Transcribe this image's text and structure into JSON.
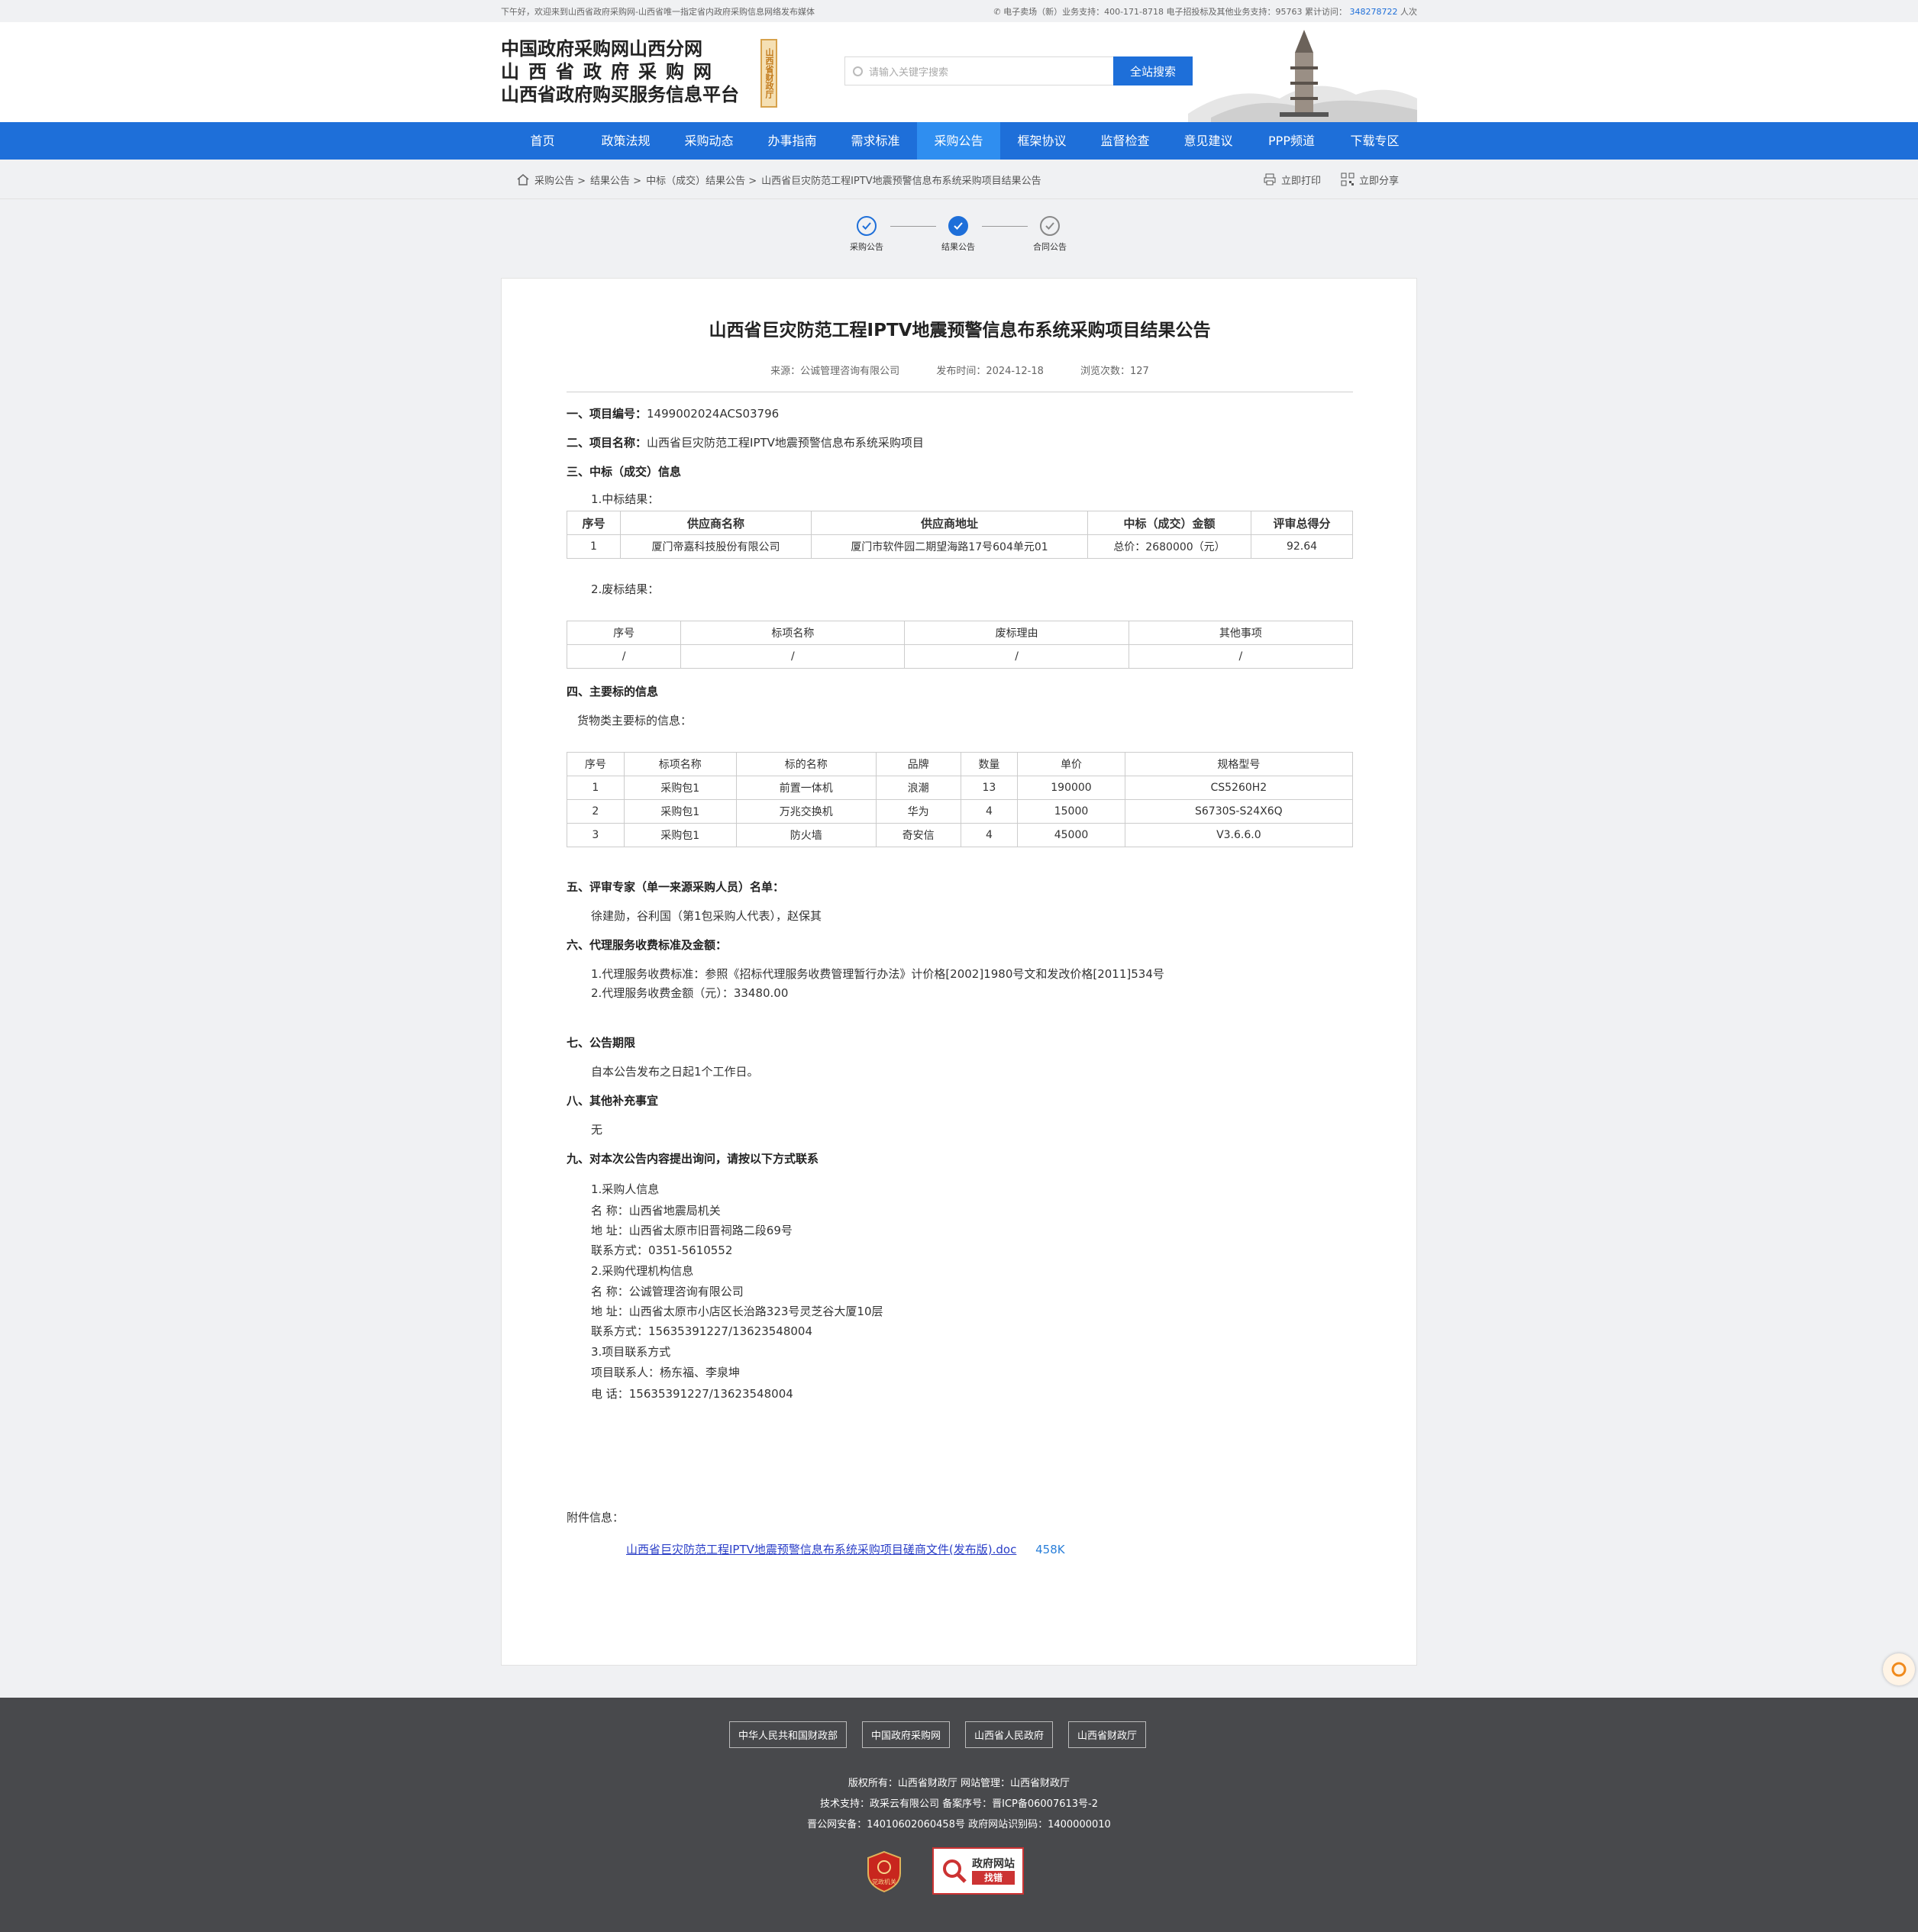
{
  "topbar": {
    "welcome": "下午好，欢迎来到山西省政府采购网-山西省唯一指定省内政府采购信息网络发布媒体",
    "support": "电子卖场（新）业务支持：400-171-8718 电子招投标及其他业务支持：95763",
    "visit_label": "累计访问：",
    "visit_count": "348278722",
    "visit_unit": "人次"
  },
  "logo": {
    "line1": "中国政府采购网山西分网",
    "line2": "山西省政府采购网",
    "line3": "山西省政府购买服务信息平台",
    "seal": "山西省财政厅"
  },
  "search": {
    "placeholder": "请输入关键字搜索",
    "button": "全站搜索"
  },
  "nav": [
    "首页",
    "政策法规",
    "采购动态",
    "办事指南",
    "需求标准",
    "采购公告",
    "框架协议",
    "监督检查",
    "意见建议",
    "PPP频道",
    "下载专区"
  ],
  "breadcrumb": [
    "采购公告 >",
    "结果公告 >",
    "中标（成交）结果公告 >",
    "山西省巨灾防范工程IPTV地震预警信息布系统采购项目结果公告"
  ],
  "tools": {
    "print": "立即打印",
    "share": "立即分享"
  },
  "steps": [
    "采购公告",
    "结果公告",
    "合同公告"
  ],
  "article": {
    "title": "山西省巨灾防范工程IPTV地震预警信息布系统采购项目结果公告",
    "source": "来源：公诚管理咨询有限公司",
    "date": "发布时间：2024-12-18",
    "views": "浏览次数：127",
    "s1_label": "一、项目编号：",
    "s1_value": "1499002024ACS03796",
    "s2_label": "二、项目名称：",
    "s2_value": "山西省巨灾防范工程IPTV地震预警信息布系统采购项目",
    "s3": "三、中标（成交）信息",
    "s3_sub1": "1.中标结果：",
    "win_headers": [
      "序号",
      "供应商名称",
      "供应商地址",
      "中标（成交）金额",
      "评审总得分"
    ],
    "win_row": [
      "1",
      "厦门帝嘉科技股份有限公司",
      "厦门市软件园二期望海路17号604单元01",
      "总价：2680000（元）",
      "92.64"
    ],
    "s3_sub2": "2.废标结果：",
    "fail_headers": [
      "序号",
      "标项名称",
      "废标理由",
      "其他事项"
    ],
    "fail_row": [
      "/",
      "/",
      "/",
      "/"
    ],
    "s4": "四、主要标的信息",
    "s4_sub": "货物类主要标的信息：",
    "goods_headers": [
      "序号",
      "标项名称",
      "标的名称",
      "品牌",
      "数量",
      "单价",
      "规格型号"
    ],
    "goods_rows": [
      [
        "1",
        "采购包1",
        "前置一体机",
        "浪潮",
        "13",
        "190000",
        "CS5260H2"
      ],
      [
        "2",
        "采购包1",
        "万兆交换机",
        "华为",
        "4",
        "15000",
        "S6730S-S24X6Q"
      ],
      [
        "3",
        "采购包1",
        "防火墙",
        "奇安信",
        "4",
        "45000",
        "V3.6.6.0"
      ]
    ],
    "s5": "五、评审专家（单一来源采购人员）名单：",
    "s5_value": "徐建勋，谷利国（第1包采购人代表），赵保其",
    "s6": "六、代理服务收费标准及金额：",
    "s6_line1": "1.代理服务收费标准：参照《招标代理服务收费管理暂行办法》计价格[2002]1980号文和发改价格[2011]534号",
    "s6_line2": "2.代理服务收费金额（元）：33480.00",
    "s7": "七、公告期限",
    "s7_value": "自本公告发布之日起1个工作日。",
    "s8": "八、其他补充事宜",
    "s8_value": "无",
    "s9": "九、对本次公告内容提出询问，请按以下方式联系",
    "contact": [
      "1.采购人信息",
      "名 称：山西省地震局机关",
      "地 址：山西省太原市旧晋祠路二段69号",
      "联系方式：0351-5610552",
      "2.采购代理机构信息",
      "名 称：公诚管理咨询有限公司",
      "地 址：山西省太原市小店区长治路323号灵芝谷大厦10层",
      "联系方式：15635391227/13623548004",
      "3.项目联系方式",
      "项目联系人：杨东福、李泉坤",
      "电 话：15635391227/13623548004"
    ],
    "attach_label": "附件信息：",
    "attach_name": "山西省巨灾防范工程IPTV地震预警信息布系统采购项目磋商文件(发布版).doc",
    "attach_size": "458K"
  },
  "footer": {
    "links": [
      "中华人民共和国财政部",
      "中国政府采购网",
      "山西省人民政府",
      "山西省财政厅"
    ],
    "line1": "版权所有：山西省财政厅 网站管理：山西省财政厅",
    "line2": "技术支持：政采云有限公司 备案序号：晋ICP备06007613号-2",
    "line3": "晋公网安备：14010602060458号 政府网站识别码：1400000010",
    "badge_text": "政府网站",
    "badge_sub": "找错",
    "badge1_text": "党政机关"
  }
}
